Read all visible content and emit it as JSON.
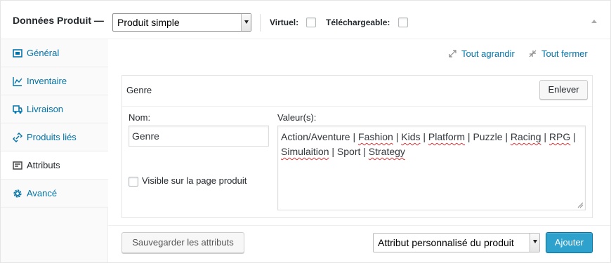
{
  "header": {
    "title": "Données Produit —",
    "product_type": "Produit simple",
    "virtual_label": "Virtuel:",
    "downloadable_label": "Téléchargeable:"
  },
  "sidebar": {
    "items": [
      {
        "label": "Général",
        "icon": "grid-icon"
      },
      {
        "label": "Inventaire",
        "icon": "chart-icon"
      },
      {
        "label": "Livraison",
        "icon": "truck-icon"
      },
      {
        "label": "Produits liés",
        "icon": "link-icon"
      },
      {
        "label": "Attributs",
        "icon": "list-icon"
      },
      {
        "label": "Avancé",
        "icon": "gear-icon"
      }
    ],
    "active": "Attributs"
  },
  "toolbar": {
    "expand_all": "Tout agrandir",
    "collapse_all": "Tout fermer"
  },
  "attribute": {
    "heading": "Genre",
    "remove_label": "Enlever",
    "name_label": "Nom:",
    "name_value": "Genre",
    "values_label": "Valeur(s):",
    "values_text": "Action/Aventure | Fashion | Kids | Platform | Puzzle | Racing | RPG | Simulaition | Sport | Strategy",
    "visible_label": "Visible sur la page produit"
  },
  "footer": {
    "save_label": "Sauvegarder les attributs",
    "attribute_select": "Attribut personnalisé du produit",
    "add_label": "Ajouter"
  },
  "colors": {
    "link": "#0073aa",
    "primary_button": "#2ea2cc"
  }
}
